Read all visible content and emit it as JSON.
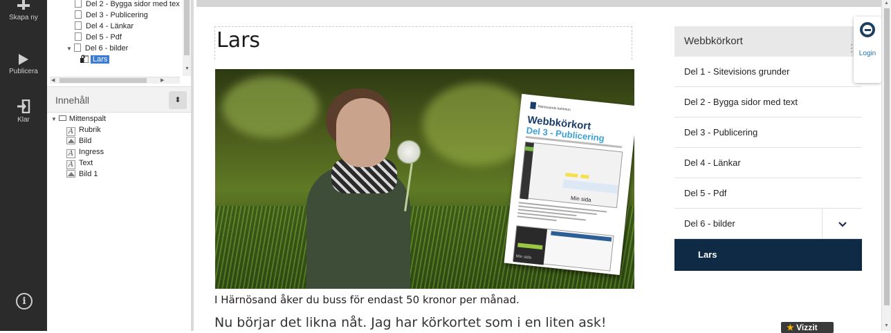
{
  "toolbar": {
    "create_label": "Skapa ny",
    "publish_label": "Publicera",
    "done_label": "Klar",
    "info_glyph": "i"
  },
  "nav_tree": {
    "items": [
      {
        "label": "Del 2 - Bygga sidor med tex",
        "icon": "page-icon"
      },
      {
        "label": "Del 3 - Publicering",
        "icon": "page-icon"
      },
      {
        "label": "Del 4 - Länkar",
        "icon": "page-icon"
      },
      {
        "label": "Del 5 - Pdf",
        "icon": "page-icon"
      },
      {
        "label": "Del 6 - bilder",
        "icon": "page-icon",
        "expanded": true
      },
      {
        "label": "Lars",
        "icon": "page-lock-icon",
        "selected": true
      }
    ]
  },
  "content_panel": {
    "header_label": "Innehåll",
    "sort_glyph": "⬍",
    "tree": [
      {
        "label": "Mittenspalt",
        "icon": "container-icon"
      },
      {
        "label": "Rubrik",
        "icon": "text-module-icon"
      },
      {
        "label": "Bild",
        "icon": "image-module-icon"
      },
      {
        "label": "Ingress",
        "icon": "text-module-icon"
      },
      {
        "label": "Text",
        "icon": "text-module-icon"
      },
      {
        "label": "Bild 1",
        "icon": "image-module-icon"
      }
    ]
  },
  "page": {
    "title": "Lars",
    "image_caption": "I Härnösand åker du buss för endast 50 kronor per månad.",
    "lead": "Nu börjar det likna nåt. Jag har körkortet som i en liten ask!",
    "flyer": {
      "logo_text": "Härnösands kommun",
      "title": "Webbkörkort",
      "subtitle": "Del 3 - Publicering",
      "mini_page_label": "Min sida"
    }
  },
  "right_menu": {
    "header": "Webbkörkort",
    "items": [
      {
        "label": "Del 1 - Sitevisions grunder"
      },
      {
        "label": "Del 2 - Bygga sidor med text"
      },
      {
        "label": "Del 3 - Publicering"
      },
      {
        "label": "Del 4 - Länkar"
      },
      {
        "label": "Del 5 - Pdf"
      },
      {
        "label": "Del 6 - bilder",
        "has_children": true
      }
    ],
    "active_child": "Lars",
    "chevron_glyph": "⌄"
  },
  "login_widget": {
    "label": "Login"
  },
  "vizzit": {
    "star": "★",
    "label": "Vizzit"
  },
  "colors": {
    "toolbar_bg": "#2b2b2b",
    "menu_active_bg": "#0f2a44",
    "selection_blue": "#3a7bd5",
    "flyer_blue": "#1a3d6b",
    "flyer_light_blue": "#3aa0d8"
  }
}
